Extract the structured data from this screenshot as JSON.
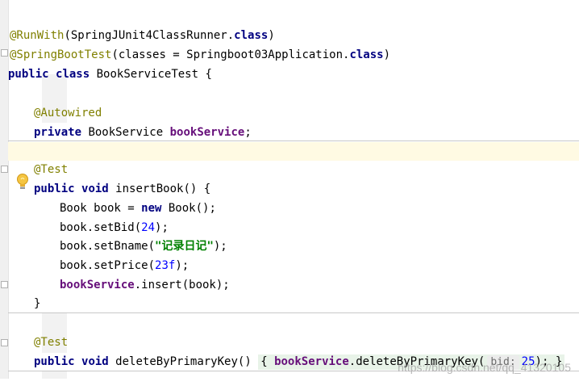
{
  "editor": {
    "line1": {
      "annotation": "@RunWith",
      "rest": "(SpringJUnit4ClassRunner.",
      "kw": "class",
      "close": ")"
    },
    "line2": {
      "annotation": "@SpringBootTest",
      "rest": "(classes = Springboot03Application.",
      "kw": "class",
      "close": ")"
    },
    "line3": {
      "kw1": "public",
      "kw2": "class",
      "rest": "BookServiceTest {"
    },
    "line5": {
      "annotation": "@Autowired"
    },
    "line6": {
      "kw": "private",
      "type": "BookService",
      "field": "bookService",
      "semi": ";"
    },
    "line8": {
      "annotation": "@Test"
    },
    "line9": {
      "kw1": "public",
      "kw2": "void",
      "rest": "insertBook() {"
    },
    "line10": {
      "pre": "Book book = ",
      "kw": "new",
      "post": " Book();"
    },
    "line11": {
      "pre": "book.setBid(",
      "num": "24",
      "post": ");"
    },
    "line12": {
      "pre": "book.setBname(",
      "str": "\"记录日记\"",
      "post": ");"
    },
    "line13": {
      "pre": "book.setPrice(",
      "num": "23f",
      "post": ");"
    },
    "line14": {
      "field": "bookService",
      "post": ".insert(book);"
    },
    "line15": {
      "brace": "}"
    },
    "line17": {
      "annotation": "@Test"
    },
    "line18": {
      "kw1": "public",
      "kw2": "void",
      "method": "deleteByPrimaryKey()",
      "open": "{",
      "field": "bookService",
      "call": ".deleteByPrimaryKey(",
      "hint": "bid:",
      "num": "25",
      "post": ");",
      "close": "}"
    }
  },
  "watermark": "https://blog.csdn.net/qq_41320105",
  "icons": {
    "bulb": "lightbulb-icon",
    "fold": "fold-marker-icon"
  },
  "colors": {
    "annotation": "#808000",
    "keyword": "#000080",
    "field": "#660e7a",
    "number": "#0000ff",
    "string": "#008000",
    "highlight_line": "#fffae3"
  }
}
